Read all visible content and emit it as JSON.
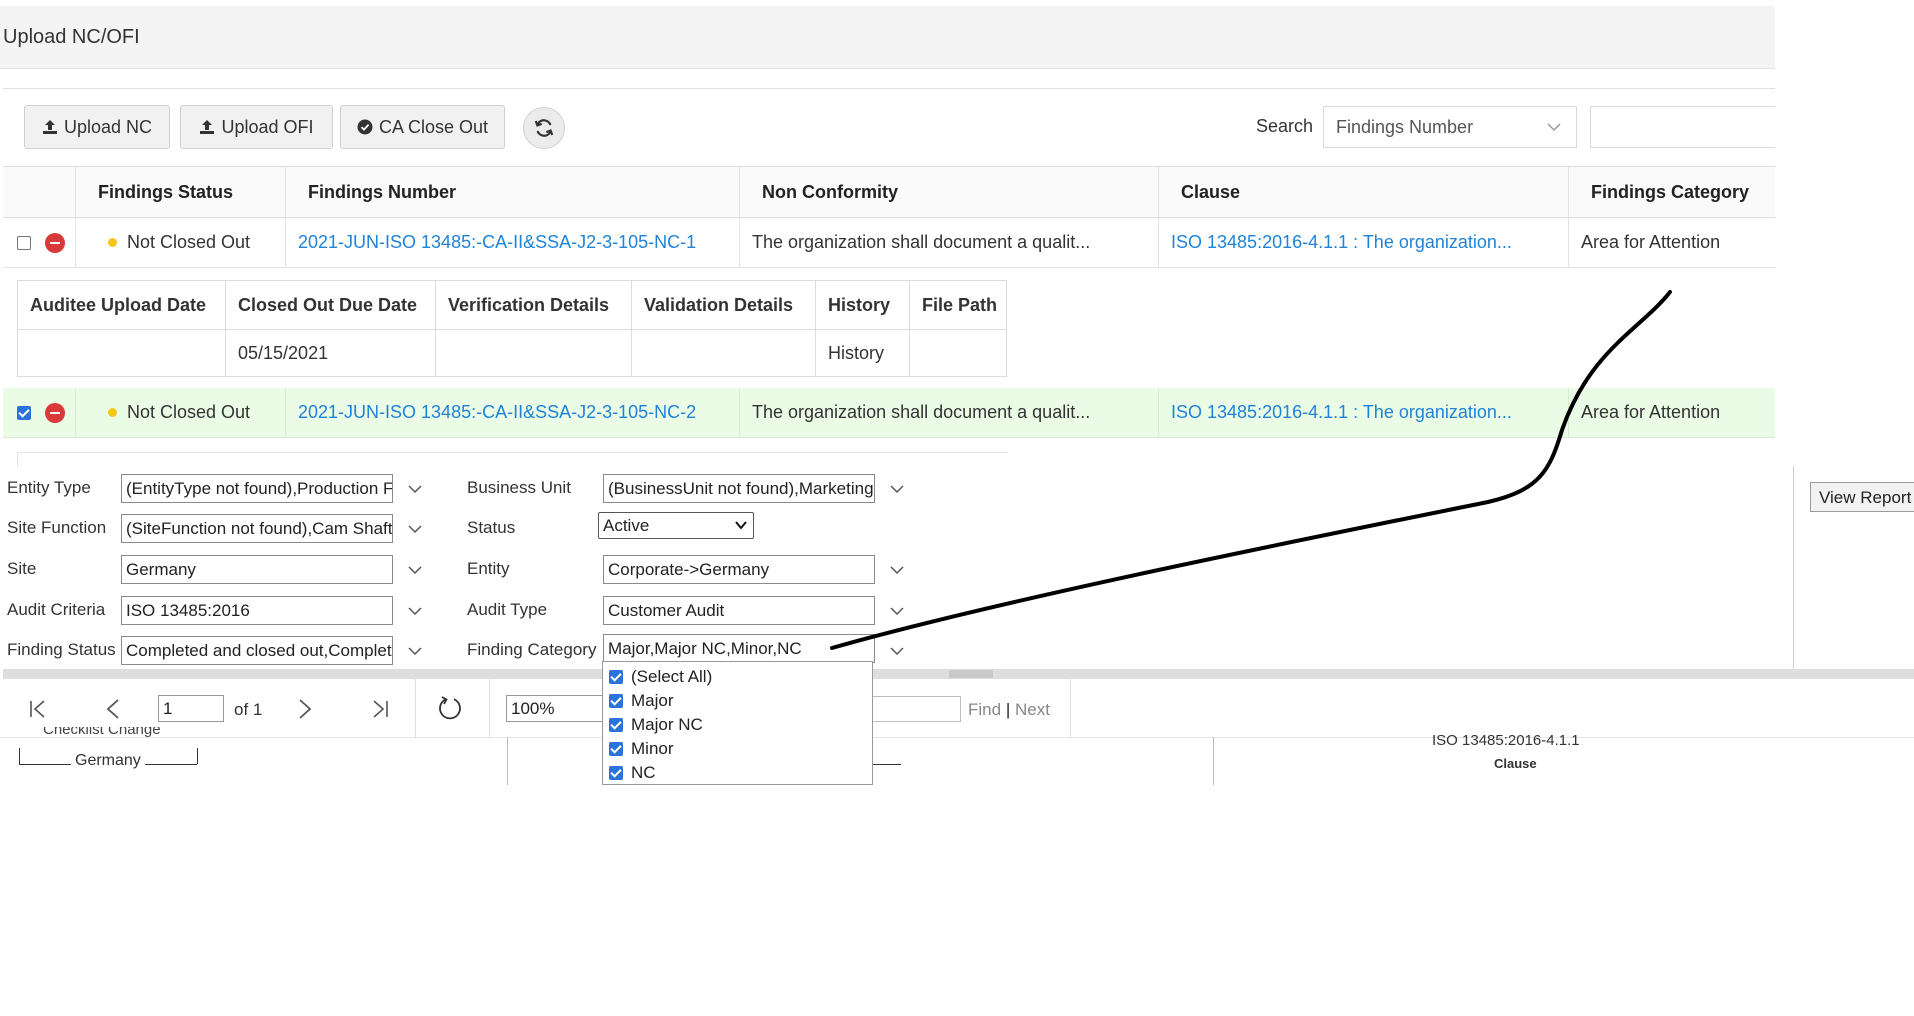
{
  "page": {
    "title": "Upload NC/OFI"
  },
  "toolbar": {
    "upload_nc": "Upload NC",
    "upload_ofi": "Upload OFI",
    "ca_close_out": "CA Close Out",
    "search_label": "Search",
    "search_field": "Findings Number",
    "search_value": ""
  },
  "grid": {
    "columns": [
      "Findings Status",
      "Findings Number",
      "Non Conformity",
      "Clause",
      "Findings Category"
    ],
    "rows": [
      {
        "checked": false,
        "status": "Not Closed Out",
        "number": "2021-JUN-ISO 13485:-CA-II&SSA-J2-3-105-NC-1",
        "non_conformity": "The organization shall document a qualit...",
        "clause": "ISO 13485:2016-4.1.1 : The organization...",
        "category": "Area for Attention"
      },
      {
        "checked": true,
        "status": "Not Closed Out",
        "number": "2021-JUN-ISO 13485:-CA-II&SSA-J2-3-105-NC-2",
        "non_conformity": "The organization shall document a qualit...",
        "clause": "ISO 13485:2016-4.1.1 : The organization...",
        "category": "Area for Attention"
      }
    ],
    "status_color": "#f5c518",
    "selected_row_color": "#eafbe6",
    "link_color": "#1f83d8"
  },
  "detail": {
    "columns": [
      "Auditee Upload Date",
      "Closed Out Due Date",
      "Verification Details",
      "Validation Details",
      "History",
      "File Path"
    ],
    "row": {
      "auditee_upload_date": "",
      "closed_out_due_date": "05/15/2021",
      "verification_details": "",
      "validation_details": "",
      "history": "History",
      "file_path": ""
    }
  },
  "params": {
    "entity_type": {
      "label": "Entity Type",
      "value": "(EntityType not found),Production F"
    },
    "site_function": {
      "label": "Site Function",
      "value": "(SiteFunction not found),Cam Shaft"
    },
    "site": {
      "label": "Site",
      "value": "Germany"
    },
    "audit_criteria": {
      "label": "Audit Criteria",
      "value": "ISO 13485:2016"
    },
    "finding_status": {
      "label": "Finding Status",
      "value": "Completed and closed out,Complet"
    },
    "business_unit": {
      "label": "Business Unit",
      "value": "(BusinessUnit not found),Marketing"
    },
    "status": {
      "label": "Status",
      "value": "Active"
    },
    "entity": {
      "label": "Entity",
      "value": "Corporate->Germany"
    },
    "audit_type": {
      "label": "Audit Type",
      "value": "Customer Audit"
    },
    "finding_category": {
      "label": "Finding Category",
      "value": "Major,Major NC,Minor,NC",
      "options": [
        {
          "label": "(Select All)",
          "checked": true
        },
        {
          "label": "Major",
          "checked": true
        },
        {
          "label": "Major NC",
          "checked": true
        },
        {
          "label": "Minor",
          "checked": true
        },
        {
          "label": "NC",
          "checked": true
        }
      ]
    },
    "view_report": "View Report"
  },
  "report_toolbar": {
    "page": "1",
    "of_pages": "of 1",
    "zoom": "100%",
    "find": "Find",
    "separator": "|",
    "next": "Next"
  },
  "report_preview": {
    "text_left_top": "Checklist Change",
    "text_left": "Germany",
    "text_right": "ISO 13485:2016-4.1.1",
    "text_right_caption": "Clause"
  }
}
